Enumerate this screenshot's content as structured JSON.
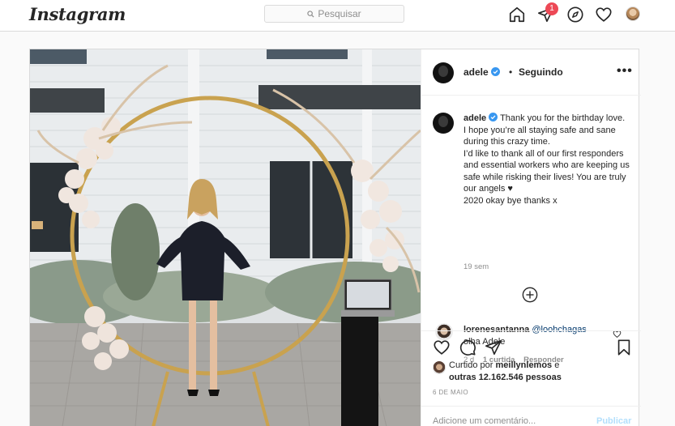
{
  "nav": {
    "logo": "Instagram",
    "search_placeholder": "Pesquisar",
    "activity_badge": "1",
    "icons": [
      "home-icon",
      "direct-icon",
      "explore-icon",
      "activity-heart-icon",
      "profile-avatar"
    ]
  },
  "post": {
    "header": {
      "username": "adele",
      "separator": "•",
      "follow_status": "Seguindo",
      "more_label": "•••"
    },
    "caption": {
      "username": "adele",
      "lines": [
        "Thank you for the birthday love. I hope you’re all staying safe and sane during this crazy time.",
        "I’d like to thank all of our first responders and essential workers who are keeping us safe while risking their lives! You are truly our angels ♥",
        "2020 okay bye thanks x"
      ],
      "age": "19 sem"
    },
    "reply": {
      "username": "lorenesantanna",
      "mention": "@loohchagas",
      "text": "olha Adele",
      "age": "2 d",
      "likes": "1 curtida",
      "reply_label": "Responder"
    },
    "likes": {
      "prefix": "Curtido por",
      "user": "meillynlemos",
      "connector": "e",
      "others": "outras 12.162.546 pessoas"
    },
    "date": "6 DE MAIO",
    "add_comment_placeholder": "Adicione um comentário...",
    "publish_label": "Publicar"
  },
  "colors": {
    "border": "#dbdbdb",
    "text": "#262626",
    "muted": "#8e8e8e",
    "badge": "#ed4956",
    "link": "#00376b",
    "verified": "#3897f0",
    "publish_disabled": "#b2dffc"
  }
}
